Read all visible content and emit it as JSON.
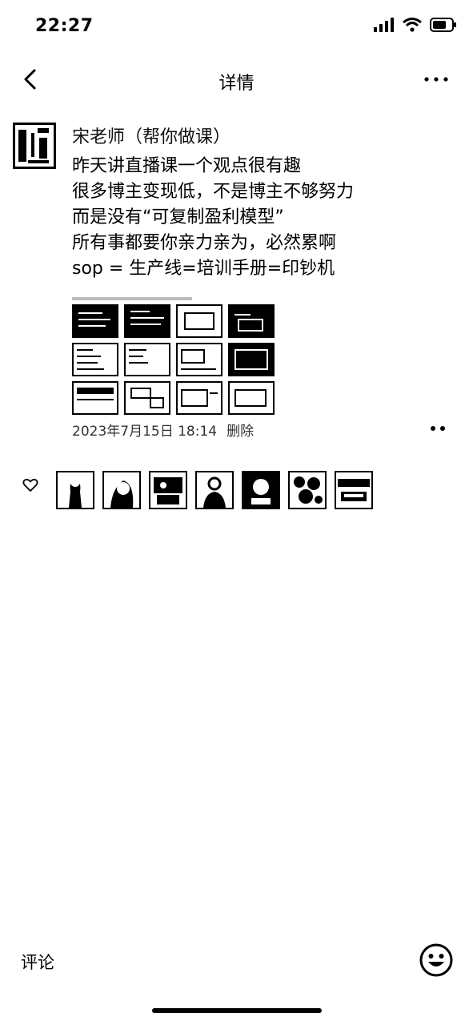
{
  "status_bar": {
    "time": "22:27"
  },
  "nav": {
    "title": "详情"
  },
  "post": {
    "author": "宋老师（帮你做课）",
    "lines": [
      "昨天讲直播课一个观点很有趣",
      "很多博主变现低，不是博主不够努力",
      "而是没有“可复制盈利模型”",
      "所有事都要你亲力亲为，必然累啊",
      "sop = 生产线=培训手册=印钞机"
    ],
    "image_count": 12,
    "timestamp": "2023年7月15日 18:14",
    "delete_label": "删除"
  },
  "likes": {
    "count": 7
  },
  "comment": {
    "label": "评论"
  }
}
